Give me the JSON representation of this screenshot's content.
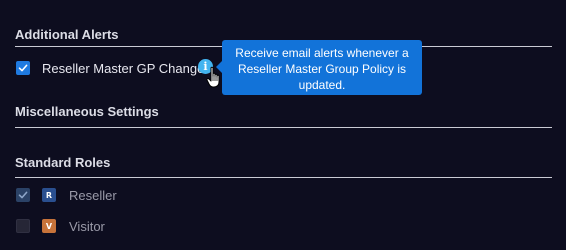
{
  "sections": {
    "additional_alerts": {
      "title": "Additional Alerts",
      "items": [
        {
          "label": "Reseller Master GP Changes",
          "checked": true,
          "tooltip": "Receive email alerts whenever a Reseller Master Group Policy is updated."
        }
      ]
    },
    "miscellaneous_settings": {
      "title": "Miscellaneous Settings"
    },
    "standard_roles": {
      "title": "Standard Roles",
      "roles": [
        {
          "badge": "R",
          "label": "Reseller",
          "checked": true,
          "disabled": true,
          "color": "#2a4f8f"
        },
        {
          "badge": "V",
          "label": "Visitor",
          "checked": false,
          "disabled": true,
          "color": "#c7733a"
        }
      ]
    }
  },
  "colors": {
    "background": "#0d0d1f",
    "accent": "#1f7ae0",
    "tooltip": "#1273d9",
    "info_icon": "#42b4f0"
  },
  "icons": {
    "info": "i",
    "checkmark": "checkmark-icon",
    "cursor": "hand-pointer-icon"
  }
}
